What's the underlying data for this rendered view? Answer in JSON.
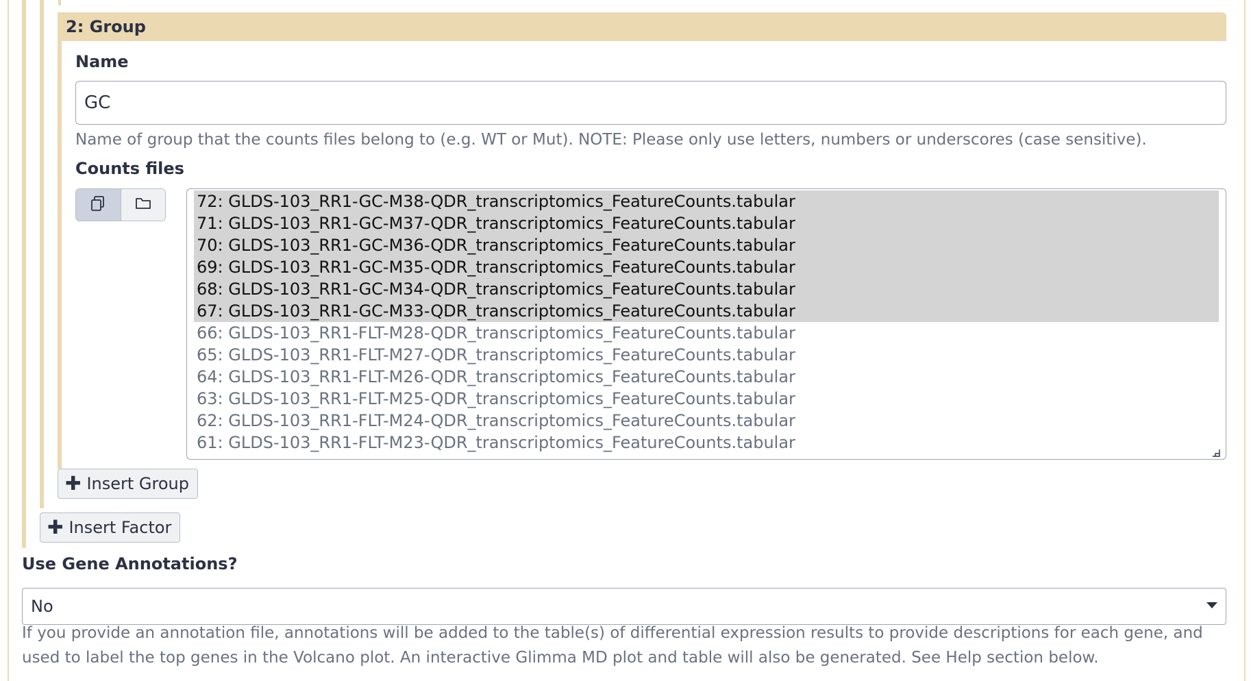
{
  "group": {
    "header": "2: Group",
    "name_label": "Name",
    "name_value": "GC",
    "name_help": "Name of group that the counts files belong to (e.g. WT or Mut). NOTE: Please only use letters, numbers or underscores (case sensitive).",
    "counts_label": "Counts files",
    "mode_buttons": [
      {
        "icon": "multiple-datasets-icon",
        "active": true
      },
      {
        "icon": "folder-icon",
        "active": false
      }
    ],
    "files": [
      {
        "label": "72: GLDS-103_RR1-GC-M38-QDR_transcriptomics_FeatureCounts.tabular",
        "selected": true
      },
      {
        "label": "71: GLDS-103_RR1-GC-M37-QDR_transcriptomics_FeatureCounts.tabular",
        "selected": true
      },
      {
        "label": "70: GLDS-103_RR1-GC-M36-QDR_transcriptomics_FeatureCounts.tabular",
        "selected": true
      },
      {
        "label": "69: GLDS-103_RR1-GC-M35-QDR_transcriptomics_FeatureCounts.tabular",
        "selected": true
      },
      {
        "label": "68: GLDS-103_RR1-GC-M34-QDR_transcriptomics_FeatureCounts.tabular",
        "selected": true
      },
      {
        "label": "67: GLDS-103_RR1-GC-M33-QDR_transcriptomics_FeatureCounts.tabular",
        "selected": true
      },
      {
        "label": "66: GLDS-103_RR1-FLT-M28-QDR_transcriptomics_FeatureCounts.tabular",
        "selected": false
      },
      {
        "label": "65: GLDS-103_RR1-FLT-M27-QDR_transcriptomics_FeatureCounts.tabular",
        "selected": false
      },
      {
        "label": "64: GLDS-103_RR1-FLT-M26-QDR_transcriptomics_FeatureCounts.tabular",
        "selected": false
      },
      {
        "label": "63: GLDS-103_RR1-FLT-M25-QDR_transcriptomics_FeatureCounts.tabular",
        "selected": false
      },
      {
        "label": "62: GLDS-103_RR1-FLT-M24-QDR_transcriptomics_FeatureCounts.tabular",
        "selected": false
      },
      {
        "label": "61: GLDS-103_RR1-FLT-M23-QDR_transcriptomics_FeatureCounts.tabular",
        "selected": false
      }
    ]
  },
  "buttons": {
    "insert_group": "Insert Group",
    "insert_factor": "Insert Factor"
  },
  "annotations": {
    "label": "Use Gene Annotations?",
    "selected": "No",
    "help": "If you provide an annotation file, annotations will be added to the table(s) of differential expression results to provide descriptions for each gene, and used to label the top genes in the Volcano plot. An interactive Glimma MD plot and table will also be generated. See Help section below."
  },
  "colors": {
    "section_tan": "#ebd9b2",
    "selected_row": "#d4d4d4",
    "text": "#2c3143",
    "help_text": "#6a7180"
  }
}
